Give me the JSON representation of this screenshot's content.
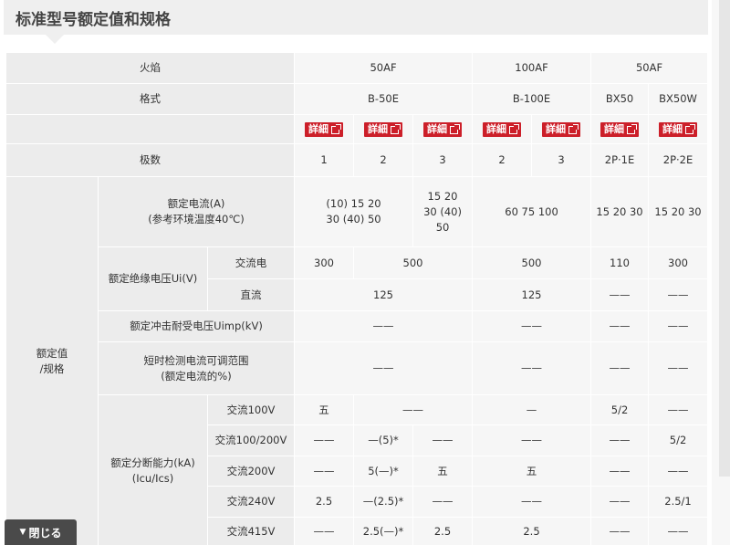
{
  "page_title": "标准型号额定值和规格",
  "detail_label": "詳細",
  "close_label": "閉じる",
  "table": {
    "h_flame": "火焰",
    "flame": [
      "50AF",
      "100AF",
      "50AF"
    ],
    "h_format": "格式",
    "format": [
      "B-50E",
      "B-100E",
      "BX50",
      "BX50W"
    ],
    "h_poles": "极数",
    "poles": [
      "1",
      "2",
      "3",
      "2",
      "3",
      "2P·1E",
      "2P·2E"
    ],
    "group_rating": [
      "额定值",
      "/规格"
    ],
    "h_current": [
      "额定电流(A)",
      "(参考环境温度40℃)"
    ],
    "current_b50_12": [
      "(10) 15 20",
      "30 (40) 50"
    ],
    "current_b50_3": [
      "15 20",
      "30 (40)",
      "50"
    ],
    "current_b100": "60 75 100",
    "current_bx50": "15 20 30",
    "current_bx50w": "15 20 30",
    "h_insulation": "额定绝缘电压Ui(V)",
    "ac_label": "交流电",
    "dc_label": "直流",
    "ins_ac": [
      "300",
      "500",
      "500",
      "110",
      "300"
    ],
    "ins_dc": [
      "125",
      "125"
    ],
    "h_impulse": "额定冲击耐受电压Uimp(kV)",
    "h_shorttime": [
      "短时检测电流可调范围",
      "(额定电流的%)"
    ],
    "h_breaking": [
      "额定分断能力(kA)",
      "(Icu/Ics)"
    ],
    "bk_labels": [
      "交流100V",
      "交流100/200V",
      "交流200V",
      "交流240V",
      "交流415V"
    ],
    "bk_100": [
      "五",
      "——",
      "—",
      "5/2",
      "——"
    ],
    "bk_100200": [
      "——",
      "—(5)*",
      "——",
      "——",
      "——",
      "5/2"
    ],
    "bk_200": [
      "——",
      "5(—)*",
      "五",
      "五",
      "——",
      "——"
    ],
    "bk_240": [
      "2.5",
      "—(2.5)*",
      "——",
      "——",
      "——",
      "2.5/1"
    ],
    "bk_415": [
      "——",
      "2.5(—)*",
      "2.5",
      "2.5",
      "——",
      "——"
    ],
    "dash": "——"
  }
}
